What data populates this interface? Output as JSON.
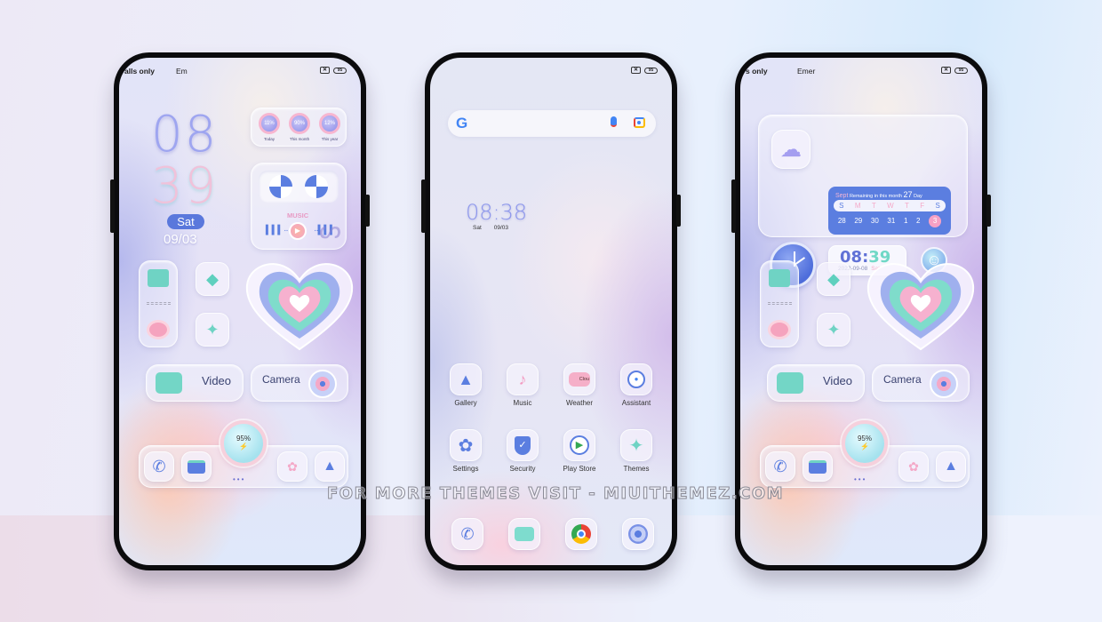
{
  "watermark": "FOR MORE THEMES VISIT - MIUITHEMEZ.COM",
  "colors": {
    "accent_blue": "#5b7ee0",
    "accent_pink": "#f7a1c5",
    "accent_teal": "#70d8c6"
  },
  "status_bar": {
    "left": {
      "carrier": "alls only",
      "emergency": "Em"
    },
    "right": {
      "carrier": "s only",
      "emergency": "Emer"
    },
    "sim_icon": "sim-x-icon",
    "battery": "95"
  },
  "phone_left": {
    "clock": {
      "hour": "08",
      "minute": "39",
      "day": "Sat",
      "date": "09/03"
    },
    "usage_widget": [
      {
        "label": "Today",
        "value": "11%"
      },
      {
        "label": "This month",
        "value": "90%"
      },
      {
        "label": "This year",
        "value": "12%"
      }
    ],
    "music_widget": {
      "label": "MUSIC"
    },
    "shortcuts": [
      {
        "label": "Video",
        "icon": "video-camera-icon"
      },
      {
        "label": "Camera",
        "icon": "camera-lens-icon"
      }
    ],
    "battery_widget": {
      "value": "95%",
      "icon": "charging-bolt-icon"
    },
    "dock": [
      "phone-icon",
      "files-icon",
      "apps-icon",
      "gallery-icon"
    ]
  },
  "phone_middle": {
    "search": {
      "google_icon": "G",
      "mic": "mic-icon",
      "lens": "lens-icon"
    },
    "clock": {
      "time_h": "08",
      "time_m": "38",
      "day": "Sat",
      "date": "09/03"
    },
    "apps_row1": [
      {
        "label": "Gallery",
        "icon": "gallery-icon"
      },
      {
        "label": "Music",
        "icon": "music-note-icon"
      },
      {
        "label": "Weather",
        "icon": "cloud-icon",
        "icon_text": "Clou"
      },
      {
        "label": "Assistant",
        "icon": "assistant-icon"
      }
    ],
    "apps_row2": [
      {
        "label": "Settings",
        "icon": "gear-icon"
      },
      {
        "label": "Security",
        "icon": "shield-check-icon"
      },
      {
        "label": "Play Store",
        "icon": "play-store-icon"
      },
      {
        "label": "Themes",
        "icon": "themes-pinwheel-icon"
      }
    ],
    "dock": [
      "phone-icon",
      "messages-icon",
      "chrome-icon",
      "camera-icon"
    ]
  },
  "phone_right": {
    "calendar": {
      "month": "Sept",
      "remaining_label": "Remaining in this month",
      "remaining_days": "27",
      "day_unit": "Day",
      "weekdays": [
        "S",
        "M",
        "T",
        "W",
        "T",
        "F",
        "S"
      ],
      "dates": [
        "28",
        "29",
        "30",
        "31",
        "1",
        "2",
        "3"
      ],
      "today": "3"
    },
    "digital_clock": {
      "h": "08",
      "m": "39",
      "date": "2022-09-08",
      "day": "Sat"
    },
    "shortcuts": [
      {
        "label": "Video",
        "icon": "video-camera-icon"
      },
      {
        "label": "Camera",
        "icon": "camera-lens-icon"
      }
    ],
    "battery_widget": {
      "value": "95%",
      "icon": "charging-bolt-icon"
    }
  }
}
